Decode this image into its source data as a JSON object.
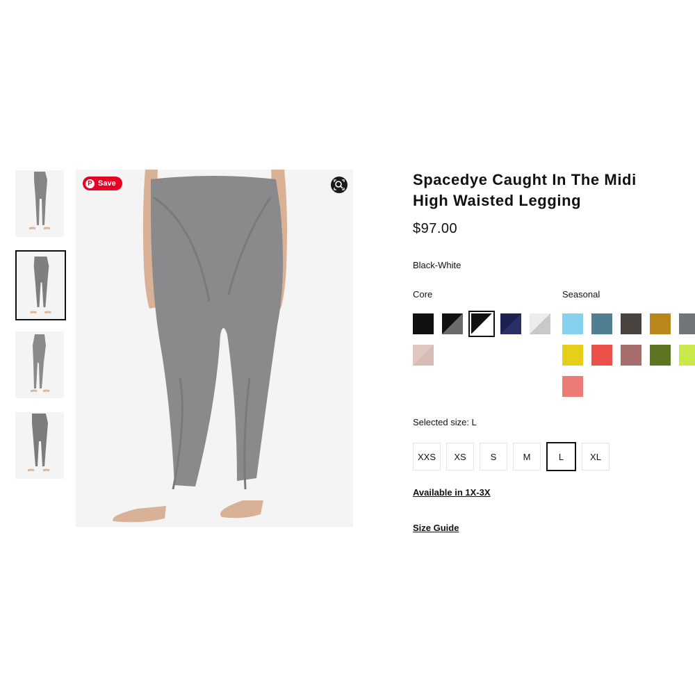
{
  "product": {
    "title_line1": "Spacedye Caught In The Midi",
    "title_line2": "High Waisted Legging",
    "price": "$97.00",
    "color_name": "Black-White"
  },
  "gallery": {
    "save_label": "Save",
    "pin_glyph": "P",
    "zoom_icon": "zoom-icon",
    "selected_thumbnail": 2,
    "thumbnails": [
      "front-view",
      "front-view-alt",
      "side-view",
      "three-quarter-view"
    ]
  },
  "colors": {
    "core_label": "Core",
    "seasonal_label": "Seasonal",
    "core": [
      {
        "name": "black",
        "primary": "#111111",
        "secondary": "#111111"
      },
      {
        "name": "black-heather",
        "primary": "#111111",
        "secondary": "#6b6b6b"
      },
      {
        "name": "black-white",
        "primary": "#111111",
        "secondary": "#ffffff",
        "selected": true
      },
      {
        "name": "navy",
        "primary": "#1c2150",
        "secondary": "#2a2f66"
      },
      {
        "name": "white-grey",
        "primary": "#ececec",
        "secondary": "#c9c9c9"
      },
      {
        "name": "blush",
        "primary": "#e0c7c1",
        "secondary": "#d7bcb6"
      }
    ],
    "seasonal": [
      {
        "name": "sky-blue",
        "primary": "#86d1ee"
      },
      {
        "name": "teal-heather",
        "primary": "#4f7f91"
      },
      {
        "name": "charcoal-brown",
        "primary": "#4a423d"
      },
      {
        "name": "mustard",
        "primary": "#b9861b"
      },
      {
        "name": "grey",
        "primary": "#707579"
      },
      {
        "name": "yellow",
        "primary": "#e6cf1a"
      },
      {
        "name": "coral",
        "primary": "#ec5149"
      },
      {
        "name": "mauve",
        "primary": "#a66f6e"
      },
      {
        "name": "olive",
        "primary": "#5f7421"
      },
      {
        "name": "lime",
        "primary": "#c9e94b"
      },
      {
        "name": "pink",
        "primary": "#ec7b77"
      }
    ]
  },
  "sizes": {
    "label": "Selected size: L",
    "options": [
      "XXS",
      "XS",
      "S",
      "M",
      "L",
      "XL"
    ],
    "selected": "L"
  },
  "links": {
    "extended_sizes": "Available in 1X-3X",
    "size_guide": "Size Guide"
  }
}
